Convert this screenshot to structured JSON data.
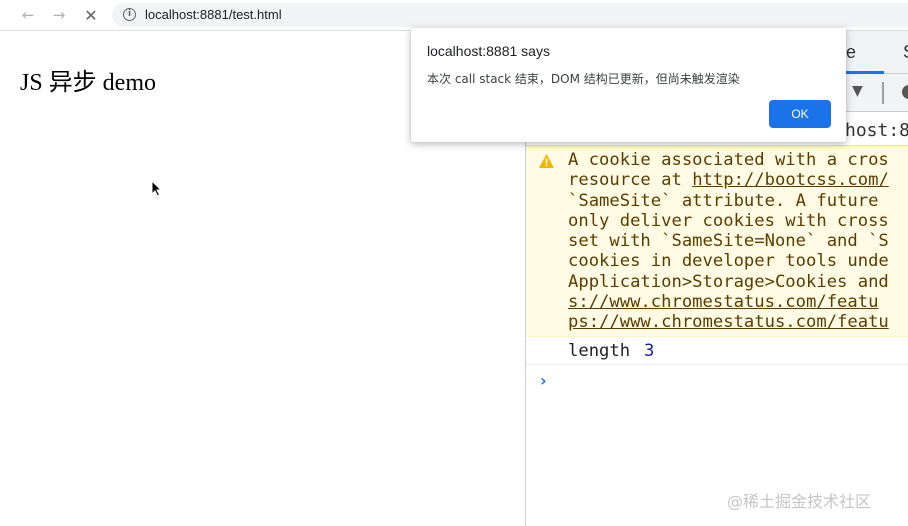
{
  "browser": {
    "back_icon": "←",
    "forward_icon": "→",
    "stop_icon": "✕",
    "info_icon": "i",
    "url": "localhost:8881/test.html"
  },
  "page": {
    "heading": "JS 异步 demo"
  },
  "devtools": {
    "tab_console_visible": "le",
    "tab_sources_visible": "S",
    "dropdown_icon": "▼",
    "filter_text_visible": "host:8",
    "warning_lines": [
      "A cookie associated with a cros",
      "resource at ",
      "`SameSite` attribute. A future",
      "only deliver cookies with cross",
      "set with `SameSite=None` and `S",
      "cookies in developer tools unde",
      "Application>Storage>Cookies and",
      "s://www.chromestatus.com/featu",
      "ps://www.chromestatus.com/featu"
    ],
    "warning_link": "http://bootcss.com/",
    "log_key": "length",
    "log_value": "3",
    "prompt_icon": "›",
    "accent_color": "#1a73e8",
    "warning_bg": "#fffbe5"
  },
  "dialog": {
    "title": "localhost:8881 says",
    "message": "本次 call stack 结束，DOM 结构已更新，但尚未触发渲染",
    "ok_label": "OK"
  },
  "watermark": "@稀土掘金技术社区"
}
